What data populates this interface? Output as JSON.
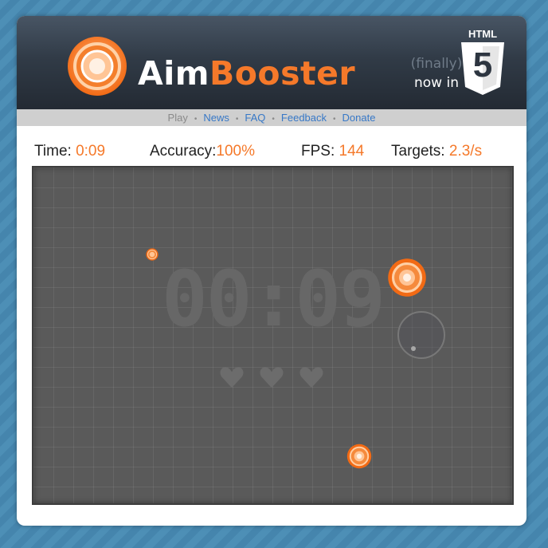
{
  "header": {
    "logo_aim": "Aim",
    "logo_booster": "Booster",
    "finally_text": "(finally)",
    "now_in_text": "now in",
    "html_badge": "HTML",
    "html_badge_number": "5"
  },
  "nav": {
    "items": [
      {
        "label": "Play",
        "active": true
      },
      {
        "label": "News"
      },
      {
        "label": "FAQ"
      },
      {
        "label": "Feedback"
      },
      {
        "label": "Donate"
      }
    ],
    "separator": "•"
  },
  "stats": {
    "time_label": "Time:",
    "time_value": "0:09",
    "accuracy_label": "Accuracy:",
    "accuracy_value": "100%",
    "fps_label": "FPS:",
    "fps_value": "144",
    "targets_label": "Targets:",
    "targets_value": "2.3/s"
  },
  "game": {
    "clock": "00:09",
    "lives_remaining": 3,
    "target_count": 3
  },
  "colors": {
    "accent": "#f5792a",
    "link": "#3778c7",
    "field": "#5a5a5a",
    "header_dark": "#232a33"
  },
  "icons": [
    "logo-target-icon",
    "html5-shield-icon",
    "heart-icon"
  ]
}
